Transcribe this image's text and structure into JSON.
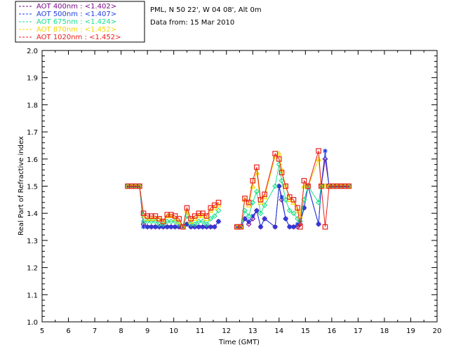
{
  "chart_data": {
    "type": "line",
    "info_lines": [
      "PML, N 50 22', W 04 08', Alt 0m",
      "Data from: 15 Mar 2010"
    ],
    "xlabel": "Time (GMT)",
    "ylabel": "Real Part of Refractive index",
    "xlim": [
      5,
      20
    ],
    "ylim": [
      1.0,
      2.0
    ],
    "xticks": [
      "5",
      "6",
      "7",
      "8",
      "9",
      "10",
      "11",
      "12",
      "13",
      "14",
      "15",
      "16",
      "17",
      "18",
      "19",
      "20"
    ],
    "yticks": [
      "1.0",
      "1.1",
      "1.2",
      "1.3",
      "1.4",
      "1.5",
      "1.6",
      "1.7",
      "1.8",
      "1.9",
      "2.0"
    ],
    "legend_position": "top-left",
    "series": [
      {
        "name": "AOT  400nm : <1.402>",
        "color": "#7a0a8a",
        "marker": "diamond",
        "x": [
          8.25,
          8.4,
          8.55,
          8.7,
          8.85,
          9.0,
          9.15,
          9.3,
          9.45,
          9.6,
          9.75,
          9.9,
          10.05,
          10.2,
          10.35,
          10.5,
          10.65,
          10.8,
          10.95,
          11.1,
          11.25,
          11.4,
          11.55,
          11.7,
          12.4,
          12.55,
          12.7,
          12.85,
          13.0,
          13.15,
          13.3,
          13.45,
          13.85,
          14.0,
          14.1,
          14.25,
          14.4,
          14.55,
          14.7,
          14.8,
          14.95,
          15.1,
          15.5,
          15.6,
          15.75,
          15.9,
          16.05,
          16.2,
          16.35,
          16.5,
          16.65
        ],
        "y": [
          1.5,
          1.5,
          1.5,
          1.5,
          1.36,
          1.35,
          1.35,
          1.35,
          1.35,
          1.35,
          1.35,
          1.35,
          1.35,
          1.35,
          1.35,
          1.36,
          1.35,
          1.35,
          1.35,
          1.35,
          1.35,
          1.35,
          1.35,
          1.37,
          1.35,
          1.35,
          1.38,
          1.36,
          1.38,
          1.41,
          1.35,
          1.38,
          1.35,
          1.5,
          1.45,
          1.38,
          1.35,
          1.35,
          1.35,
          1.36,
          1.42,
          1.5,
          1.36,
          1.5,
          1.6,
          1.5,
          1.5,
          1.5,
          1.5,
          1.5,
          1.5
        ]
      },
      {
        "name": "AOT  500nm : <1.407>",
        "color": "#1f3de0",
        "marker": "asterisk",
        "x": [
          8.25,
          8.4,
          8.55,
          8.7,
          8.85,
          9.0,
          9.15,
          9.3,
          9.45,
          9.6,
          9.75,
          9.9,
          10.05,
          10.2,
          10.35,
          10.5,
          10.65,
          10.8,
          10.95,
          11.1,
          11.25,
          11.4,
          11.55,
          11.7,
          12.4,
          12.55,
          12.7,
          12.85,
          13.0,
          13.15,
          13.3,
          13.45,
          13.85,
          14.0,
          14.1,
          14.25,
          14.4,
          14.55,
          14.7,
          14.8,
          14.95,
          15.1,
          15.5,
          15.6,
          15.75,
          15.9,
          16.05,
          16.2,
          16.35,
          16.5,
          16.65
        ],
        "y": [
          1.5,
          1.5,
          1.5,
          1.5,
          1.35,
          1.35,
          1.35,
          1.35,
          1.35,
          1.35,
          1.35,
          1.35,
          1.35,
          1.35,
          1.35,
          1.36,
          1.35,
          1.35,
          1.35,
          1.35,
          1.35,
          1.35,
          1.35,
          1.37,
          1.35,
          1.35,
          1.38,
          1.37,
          1.39,
          1.41,
          1.35,
          1.38,
          1.35,
          1.5,
          1.46,
          1.38,
          1.35,
          1.35,
          1.36,
          1.37,
          1.42,
          1.5,
          1.36,
          1.5,
          1.63,
          1.5,
          1.5,
          1.5,
          1.5,
          1.5,
          1.5
        ]
      },
      {
        "name": "AOT  675nm : <1.424>",
        "color": "#19e08c",
        "marker": "diamond",
        "x": [
          8.25,
          8.4,
          8.55,
          8.7,
          8.85,
          9.0,
          9.15,
          9.3,
          9.45,
          9.6,
          9.75,
          9.9,
          10.05,
          10.2,
          10.35,
          10.5,
          10.65,
          10.8,
          10.95,
          11.1,
          11.25,
          11.4,
          11.55,
          11.7,
          12.4,
          12.55,
          12.7,
          12.85,
          13.0,
          13.15,
          13.3,
          13.45,
          13.85,
          14.0,
          14.1,
          14.25,
          14.4,
          14.55,
          14.7,
          14.8,
          14.95,
          15.1,
          15.5,
          15.6,
          15.75,
          15.9,
          16.05,
          16.2,
          16.35,
          16.5,
          16.65
        ],
        "y": [
          1.5,
          1.5,
          1.5,
          1.5,
          1.37,
          1.37,
          1.37,
          1.37,
          1.36,
          1.36,
          1.37,
          1.37,
          1.37,
          1.36,
          1.35,
          1.39,
          1.36,
          1.36,
          1.37,
          1.37,
          1.36,
          1.38,
          1.39,
          1.41,
          1.35,
          1.35,
          1.41,
          1.39,
          1.44,
          1.48,
          1.4,
          1.43,
          1.5,
          1.58,
          1.52,
          1.45,
          1.41,
          1.4,
          1.38,
          1.37,
          1.45,
          1.5,
          1.44,
          1.5,
          1.5,
          1.5,
          1.5,
          1.5,
          1.5,
          1.5,
          1.5
        ]
      },
      {
        "name": "AOT  870nm : <1.452>",
        "color": "#f5d400",
        "marker": "triangle",
        "x": [
          8.25,
          8.4,
          8.55,
          8.7,
          8.85,
          9.0,
          9.15,
          9.3,
          9.45,
          9.6,
          9.75,
          9.9,
          10.05,
          10.2,
          10.35,
          10.5,
          10.65,
          10.8,
          10.95,
          11.1,
          11.25,
          11.4,
          11.55,
          11.7,
          12.4,
          12.55,
          12.7,
          12.85,
          13.0,
          13.15,
          13.3,
          13.45,
          13.85,
          14.0,
          14.1,
          14.25,
          14.4,
          14.55,
          14.7,
          14.8,
          14.95,
          15.1,
          15.5,
          15.6,
          15.75,
          15.9,
          16.05,
          16.2,
          16.35,
          16.5,
          16.65
        ],
        "y": [
          1.5,
          1.5,
          1.5,
          1.5,
          1.39,
          1.38,
          1.38,
          1.38,
          1.38,
          1.37,
          1.39,
          1.39,
          1.38,
          1.37,
          1.35,
          1.41,
          1.37,
          1.38,
          1.39,
          1.39,
          1.38,
          1.41,
          1.42,
          1.43,
          1.35,
          1.35,
          1.45,
          1.43,
          1.5,
          1.55,
          1.44,
          1.46,
          1.61,
          1.62,
          1.56,
          1.5,
          1.45,
          1.44,
          1.41,
          1.39,
          1.5,
          1.5,
          1.6,
          1.5,
          1.5,
          1.5,
          1.5,
          1.5,
          1.5,
          1.5,
          1.5
        ]
      },
      {
        "name": "AOT 1020nm : <1.452>",
        "color": "#e8201c",
        "marker": "square",
        "x": [
          8.25,
          8.4,
          8.55,
          8.7,
          8.85,
          9.0,
          9.15,
          9.3,
          9.45,
          9.6,
          9.75,
          9.9,
          10.05,
          10.2,
          10.35,
          10.5,
          10.65,
          10.8,
          10.95,
          11.1,
          11.25,
          11.4,
          11.55,
          11.7,
          12.4,
          12.55,
          12.7,
          12.85,
          13.0,
          13.15,
          13.3,
          13.45,
          13.85,
          14.0,
          14.1,
          14.25,
          14.4,
          14.55,
          14.7,
          14.8,
          14.95,
          15.1,
          15.5,
          15.6,
          15.75,
          15.9,
          16.05,
          16.2,
          16.35,
          16.5,
          16.65
        ],
        "y": [
          1.5,
          1.5,
          1.5,
          1.5,
          1.4,
          1.39,
          1.39,
          1.39,
          1.38,
          1.37,
          1.395,
          1.395,
          1.39,
          1.38,
          1.35,
          1.42,
          1.38,
          1.39,
          1.4,
          1.4,
          1.39,
          1.42,
          1.43,
          1.44,
          1.35,
          1.35,
          1.455,
          1.44,
          1.52,
          1.57,
          1.45,
          1.47,
          1.62,
          1.6,
          1.55,
          1.5,
          1.46,
          1.45,
          1.42,
          1.35,
          1.52,
          1.5,
          1.63,
          1.5,
          1.35,
          1.5,
          1.5,
          1.5,
          1.5,
          1.5,
          1.5
        ]
      }
    ]
  }
}
